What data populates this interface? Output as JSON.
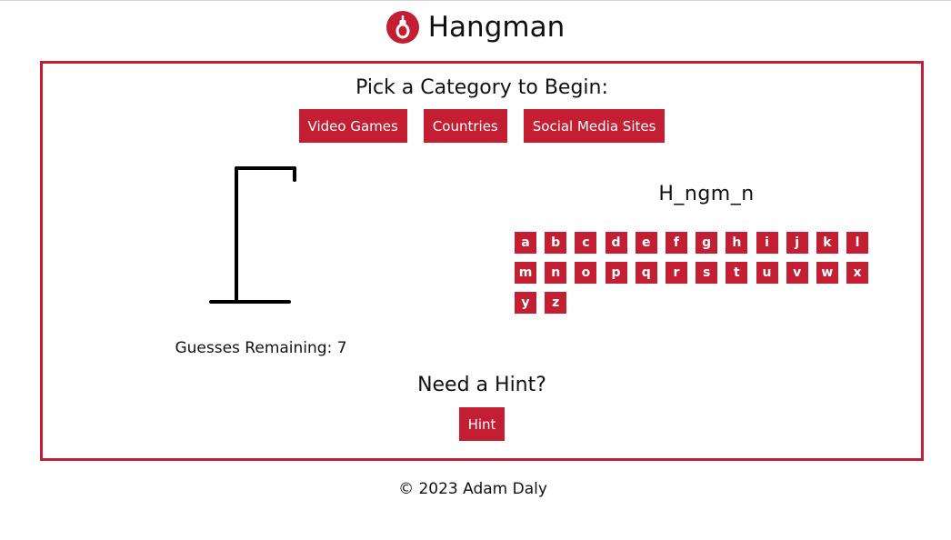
{
  "header": {
    "title": "Hangman",
    "logo_icon": "noose-icon",
    "accent_color": "#c41e32"
  },
  "categories": {
    "heading": "Pick a Category to Begin:",
    "buttons": [
      "Video Games",
      "Countries",
      "Social Media Sites"
    ]
  },
  "game": {
    "word_display": "H_ngm_n",
    "guesses_remaining": "Guesses Remaining: 7",
    "letters": [
      "a",
      "b",
      "c",
      "d",
      "e",
      "f",
      "g",
      "h",
      "i",
      "j",
      "k",
      "l",
      "m",
      "n",
      "o",
      "p",
      "q",
      "r",
      "s",
      "t",
      "u",
      "v",
      "w",
      "x",
      "y",
      "z"
    ]
  },
  "hint": {
    "heading": "Need a Hint?",
    "button_label": "Hint"
  },
  "footer": {
    "copyright": "© 2023 Adam Daly"
  }
}
